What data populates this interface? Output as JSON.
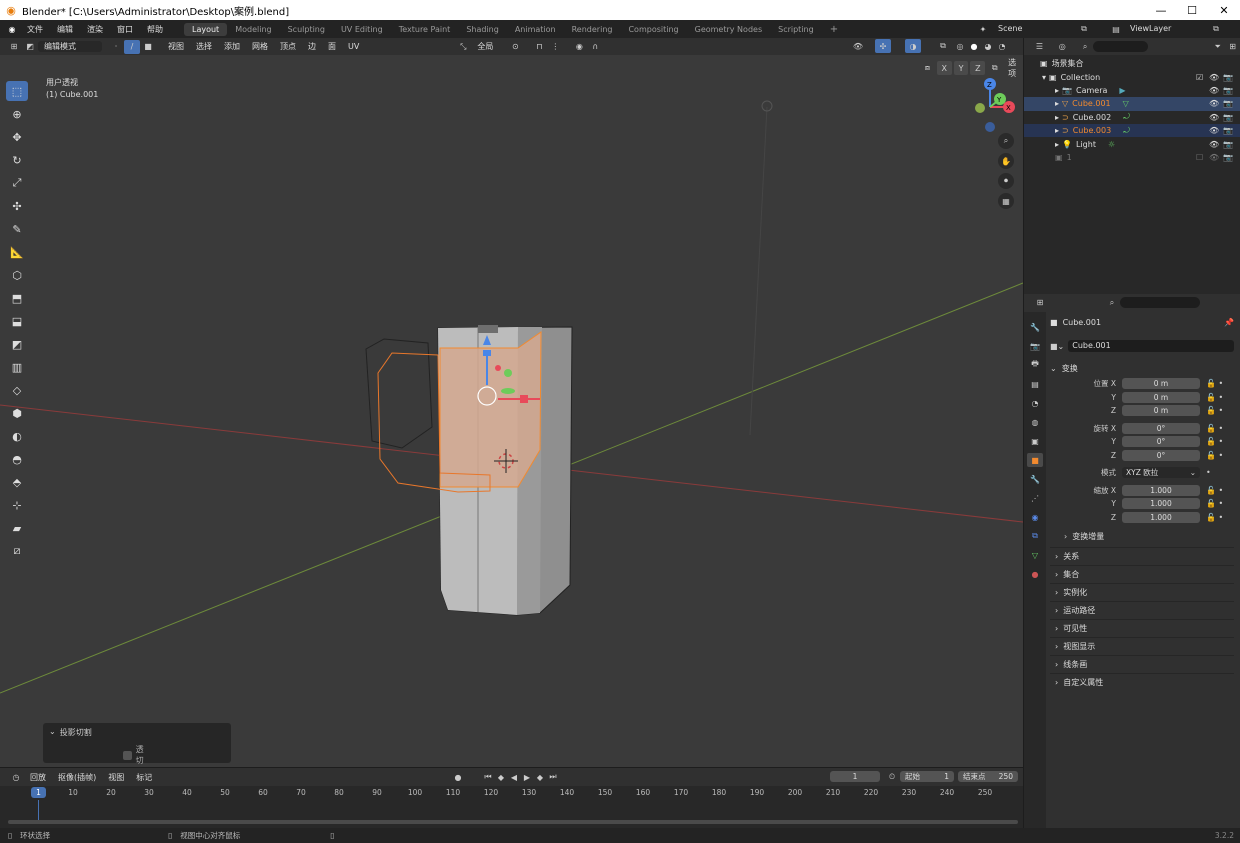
{
  "title": "Blender* [C:\\Users\\Administrator\\Desktop\\案例.blend]",
  "menus": [
    "文件",
    "编辑",
    "渲染",
    "窗口",
    "帮助"
  ],
  "workspaces": [
    "Layout",
    "Modeling",
    "Sculpting",
    "UV Editing",
    "Texture Paint",
    "Shading",
    "Animation",
    "Rendering",
    "Compositing",
    "Geometry Nodes",
    "Scripting"
  ],
  "active_workspace": "Layout",
  "add_workspace": "+",
  "scene_label": "Scene",
  "viewlayer_label": "ViewLayer",
  "viewport_header": {
    "mode": "编辑模式",
    "menus": [
      "视图",
      "选择",
      "添加",
      "网格",
      "顶点",
      "边",
      "面",
      "UV"
    ],
    "transform_orientation": "全局",
    "options": "选项",
    "axes": [
      "X",
      "Y",
      "Z"
    ]
  },
  "viewport": {
    "view_name": "用户透视",
    "object_name": "(1) Cube.001"
  },
  "navgizmo": {
    "z": "Z",
    "y": "Y",
    "x": "X"
  },
  "operator_panel": {
    "title": "投影切割",
    "option": "透切"
  },
  "outliner": {
    "root": "场景集合",
    "collection": "Collection",
    "items": [
      {
        "name": "Camera",
        "selected": false
      },
      {
        "name": "Cube.001",
        "selected": true
      },
      {
        "name": "Cube.002",
        "selected": false
      },
      {
        "name": "Cube.003",
        "selected": true
      },
      {
        "name": "Light",
        "selected": false
      }
    ],
    "extra": "1"
  },
  "properties": {
    "object_name": "Cube.001",
    "datablock": "Cube.001",
    "transform_title": "变换",
    "location_label": "位置 X",
    "rotation_label": "旋转 X",
    "scale_label": "缩放 X",
    "y": "Y",
    "z": "Z",
    "location": [
      "0 m",
      "0 m",
      "0 m"
    ],
    "rotation": [
      "0°",
      "0°",
      "0°"
    ],
    "mode_label": "模式",
    "mode_value": "XYZ 欧拉",
    "scale": [
      "1.000",
      "1.000",
      "1.000"
    ],
    "delta": "变换增量",
    "panels": [
      "关系",
      "集合",
      "实例化",
      "运动路径",
      "可见性",
      "视图显示",
      "线条画",
      "自定义属性"
    ]
  },
  "timeline": {
    "menus": [
      "回放",
      "抠像(插帧)",
      "视图",
      "标记"
    ],
    "current_frame": "1",
    "start_label": "起始",
    "start": "1",
    "end_label": "结束点",
    "end": "250",
    "ticks": [
      "10",
      "20",
      "30",
      "40",
      "50",
      "60",
      "70",
      "80",
      "90",
      "100",
      "110",
      "120",
      "130",
      "140",
      "150",
      "160",
      "170",
      "180",
      "190",
      "200",
      "210",
      "220",
      "230",
      "240",
      "250"
    ],
    "frame_marker": "1"
  },
  "status": {
    "left": "环状选择",
    "middle": "视图中心对齐鼠标",
    "version": "3.2.2"
  },
  "colors": {
    "accent": "#4772b3",
    "selected_orange": "#f28a2f",
    "viewport_bg": "#3a3a3a"
  }
}
